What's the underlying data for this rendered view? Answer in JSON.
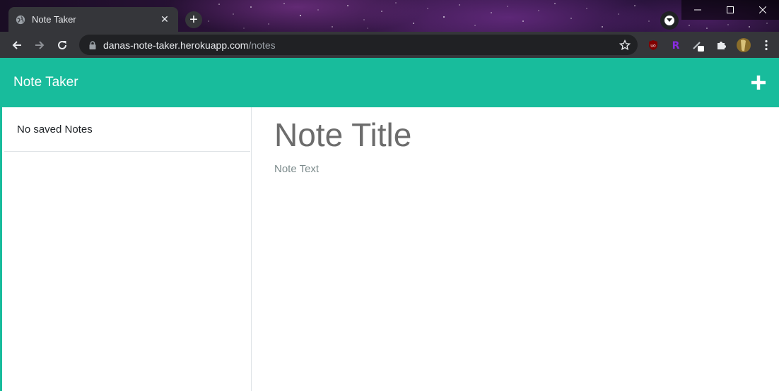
{
  "browser": {
    "tab": {
      "title": "Note Taker"
    },
    "url": {
      "host": "danas-note-taker.herokuapp.com",
      "path": "/notes"
    }
  },
  "app": {
    "brand": "Note Taker",
    "accent_color": "#18bc9c"
  },
  "sidebar": {
    "items": [
      {
        "label": "No saved Notes"
      }
    ]
  },
  "editor": {
    "title_placeholder": "Note Title",
    "text_placeholder": "Note Text"
  }
}
